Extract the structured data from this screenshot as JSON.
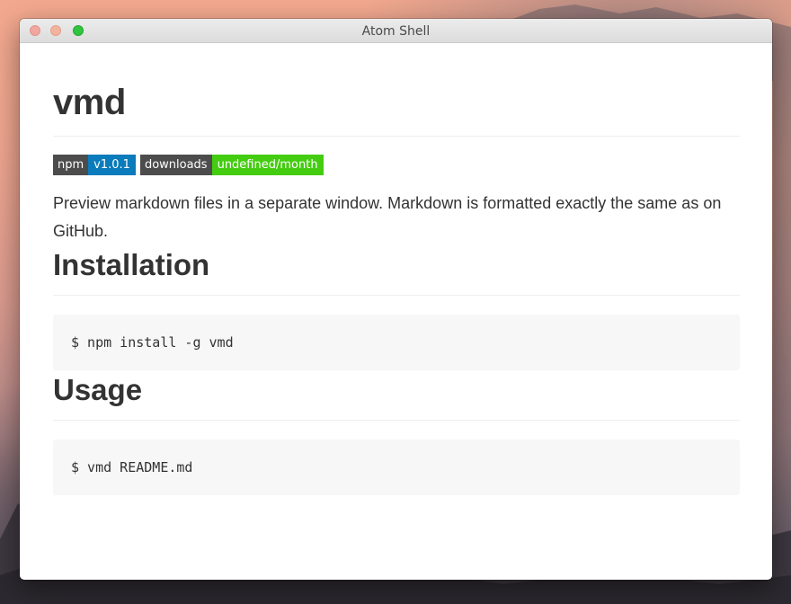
{
  "window": {
    "title": "Atom Shell"
  },
  "document": {
    "title": "vmd",
    "badges": [
      {
        "label": "npm",
        "value": "v1.0.1",
        "color": "#0a7bbb"
      },
      {
        "label": "downloads",
        "value": "undefined/month",
        "color": "#44cc11"
      }
    ],
    "intro": "Preview markdown files in a separate window. Markdown is formatted exactly the same as on GitHub.",
    "sections": [
      {
        "heading": "Installation",
        "code": "$ npm install -g vmd"
      },
      {
        "heading": "Usage",
        "code": "$ vmd README.md"
      }
    ]
  },
  "colors": {
    "close": "#f1a7a0",
    "minimize": "#f3b39f",
    "zoom": "#2fc53e",
    "badge_label_bg": "#4c4c4c"
  },
  "icons": [
    "close-icon",
    "minimize-icon",
    "zoom-icon"
  ]
}
